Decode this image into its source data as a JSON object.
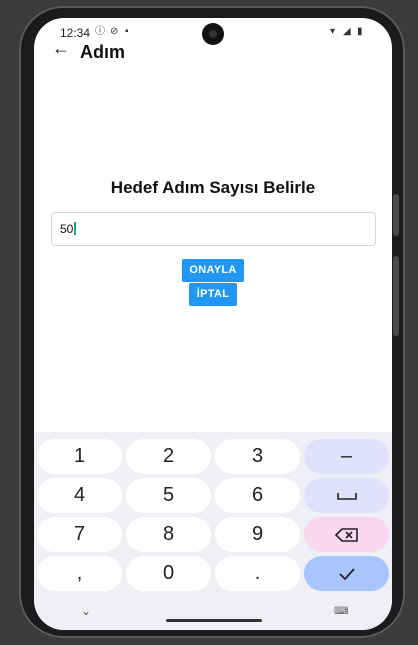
{
  "statusbar": {
    "time": "12:34",
    "icons": [
      "info-icon",
      "dnd-icon",
      "sim-icon",
      "wifi-icon",
      "signal-icon",
      "battery-icon"
    ]
  },
  "appbar": {
    "title": "Adım"
  },
  "main": {
    "heading": "Hedef Adım Sayısı Belirle",
    "input_value": "50",
    "confirm_label": "ONAYLA",
    "cancel_label": "İPTAL"
  },
  "keyboard": {
    "keys": [
      "1",
      "2",
      "3",
      "4",
      "5",
      "6",
      "7",
      "8",
      "9",
      ",",
      "0",
      "."
    ],
    "minus": "–"
  },
  "colors": {
    "accent": "#2196f3",
    "caret": "#19a389"
  }
}
